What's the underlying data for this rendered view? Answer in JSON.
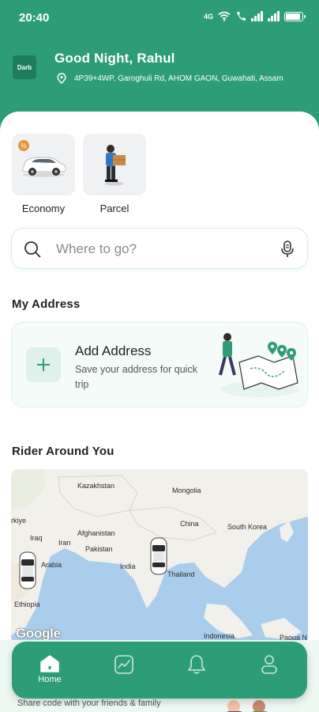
{
  "status_bar": {
    "time": "20:40",
    "network_label": "4G"
  },
  "header": {
    "logo_text": "Darb",
    "greeting": "Good Night, Rahul",
    "location": "4P39+4WP, Garoghuli Rd, AHOM GAON, Guwahati, Assam"
  },
  "services": [
    {
      "label": "Economy",
      "icon": "car-icon",
      "badge": "discount-badge-icon"
    },
    {
      "label": "Parcel",
      "icon": "parcel-delivery-icon"
    }
  ],
  "search": {
    "placeholder": "Where to go?",
    "value": ""
  },
  "address_section": {
    "title": "My Address",
    "card_title": "Add Address",
    "card_subtitle": "Save your address for quick trip"
  },
  "riders_section": {
    "title": "Rider Around You",
    "map_labels": [
      "Kazakhstan",
      "Mongolia",
      "China",
      "South Korea",
      "Afghanistan",
      "Pakistan",
      "India",
      "Thailand",
      "Iraq",
      "Iran",
      "Arabia",
      "Ethiopia",
      "Indonesia",
      "rkiye",
      "Papua N"
    ],
    "map_attribution": "Google"
  },
  "promo": {
    "text": "Share code with your friends & family"
  },
  "bottom_nav": [
    {
      "label": "Home",
      "icon": "home-icon",
      "active": true
    },
    {
      "label": "",
      "icon": "activity-icon",
      "active": false
    },
    {
      "label": "",
      "icon": "bell-icon",
      "active": false
    },
    {
      "label": "",
      "icon": "profile-icon",
      "active": false
    }
  ],
  "colors": {
    "primary": "#2d9d78",
    "card_background": "#ffffff",
    "map_water": "#a9cdea",
    "map_land": "#f2f0ea"
  }
}
